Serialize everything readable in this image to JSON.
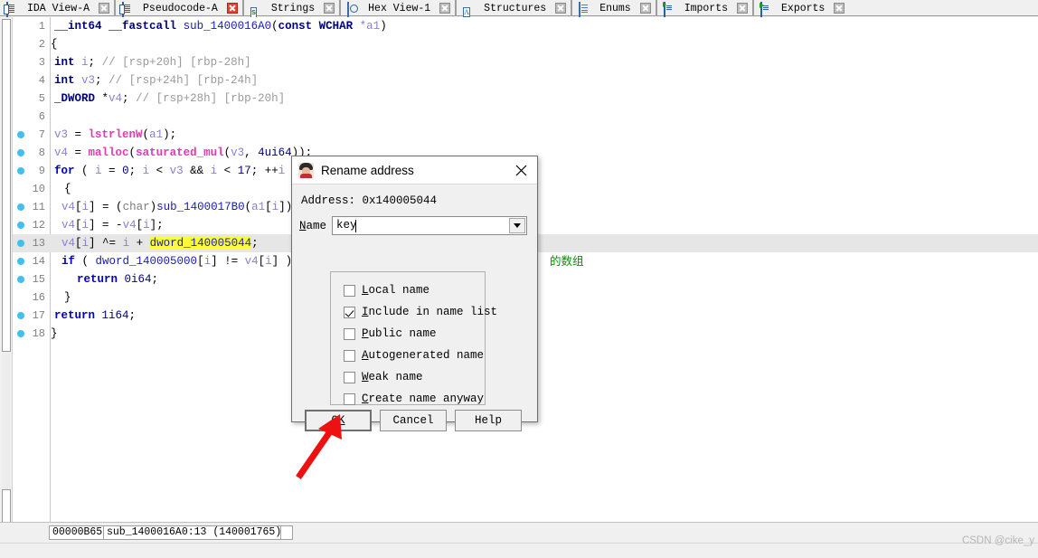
{
  "tabs": [
    {
      "label": "IDA View-A",
      "icon": "document-icon",
      "close_active": false
    },
    {
      "label": "Pseudocode-A",
      "icon": "document-icon",
      "close_active": true
    },
    {
      "label": "Strings",
      "icon": "strings-icon",
      "close_active": false
    },
    {
      "label": "Hex View-1",
      "icon": "hex-view-icon",
      "close_active": false
    },
    {
      "label": "Structures",
      "icon": "structures-icon",
      "close_active": false
    },
    {
      "label": "Enums",
      "icon": "enums-icon",
      "close_active": false
    },
    {
      "label": "Imports",
      "icon": "imports-icon",
      "close_active": false
    },
    {
      "label": "Exports",
      "icon": "exports-icon",
      "close_active": false
    }
  ],
  "code": {
    "lines": [
      {
        "num": "1",
        "breakpoint": false,
        "highlight": false
      },
      {
        "num": "2",
        "breakpoint": false,
        "highlight": false
      },
      {
        "num": "3",
        "breakpoint": false,
        "highlight": false
      },
      {
        "num": "4",
        "breakpoint": false,
        "highlight": false
      },
      {
        "num": "5",
        "breakpoint": false,
        "highlight": false
      },
      {
        "num": "6",
        "breakpoint": false,
        "highlight": false
      },
      {
        "num": "7",
        "breakpoint": true,
        "highlight": false
      },
      {
        "num": "8",
        "breakpoint": true,
        "highlight": false
      },
      {
        "num": "9",
        "breakpoint": true,
        "highlight": false
      },
      {
        "num": "10",
        "breakpoint": false,
        "highlight": false
      },
      {
        "num": "11",
        "breakpoint": true,
        "highlight": false
      },
      {
        "num": "12",
        "breakpoint": true,
        "highlight": false
      },
      {
        "num": "13",
        "breakpoint": true,
        "highlight": true
      },
      {
        "num": "14",
        "breakpoint": true,
        "highlight": false
      },
      {
        "num": "15",
        "breakpoint": true,
        "highlight": false
      },
      {
        "num": "16",
        "breakpoint": false,
        "highlight": false
      },
      {
        "num": "17",
        "breakpoint": true,
        "highlight": false
      },
      {
        "num": "18",
        "breakpoint": true,
        "highlight": false
      }
    ],
    "text": {
      "l1": "__int64 __fastcall sub_1400016A0(const WCHAR *a1)",
      "l2": "{",
      "l3_a": "  int i; ",
      "l3_b": "// [rsp+20h] [rbp-28h]",
      "l4_a": "  int v3; ",
      "l4_b": "// [rsp+24h] [rbp-24h]",
      "l5_a": "  _DWORD *v4; ",
      "l5_b": "// [rsp+28h] [rbp-20h]",
      "l7": "v3 = lstrlenW(a1);",
      "l8": "v4 = malloc(saturated_mul(v3, 4ui64));",
      "l9": "for ( i = 0; i < v3 && i < 17; ++i )",
      "l10": "  {",
      "l11": "v4[i] = (char)sub_1400017B0(a1[i]);",
      "l12": "v4[i] = -v4[i];",
      "l13": "v4[i] ^= i + dword_140005044;",
      "l14": "if ( dword_140005000[i] != v4[i] )",
      "l15": "return 0i64;",
      "l16": "  }",
      "l17": "  return 1i64;",
      "l18": "}",
      "comment_cjk": "的数组"
    },
    "tokens": {
      "int64": "__int64",
      "fastcall": "__fastcall",
      "funcname": "sub_1400016A0",
      "const": "const",
      "wchar": "WCHAR",
      "a1": "*a1",
      "int": "int",
      "dword_t": "_DWORD",
      "i": "i",
      "v3": "v3",
      "v4": "v4",
      "lstrlenw": "lstrlenW",
      "malloc": "malloc",
      "saturated_mul": "saturated_mul",
      "for": "for",
      "if": "if",
      "return": "return",
      "char": "char",
      "sub_1400017B0": "sub_1400017B0",
      "dword_140005044": "dword_140005044",
      "dword_140005000": "dword_140005000"
    }
  },
  "dialog": {
    "title": "Rename address",
    "icon": "rename-person-icon",
    "close_icon": "close-icon",
    "address_label": "Address: 0x140005044",
    "name_label_prefix": "N",
    "name_label_rest": "ame",
    "name_value": "key",
    "dropdown_icon": "chevron-down-icon",
    "checkboxes": [
      {
        "accel": "L",
        "rest": "ocal name",
        "checked": false
      },
      {
        "accel": "I",
        "rest": "nclude in name list",
        "checked": true
      },
      {
        "accel": "P",
        "rest": "ublic name",
        "checked": false
      },
      {
        "accel": "A",
        "rest": "utogenerated name",
        "checked": false
      },
      {
        "accel": "W",
        "rest": "eak name",
        "checked": false
      },
      {
        "accel": "C",
        "rest": "reate name anyway",
        "checked": false
      }
    ],
    "buttons": {
      "ok_prefix": "O",
      "ok_accel": "K",
      "ok_full": "OK",
      "cancel": "Cancel",
      "help": "Help"
    }
  },
  "statusbar": {
    "offset": "00000B65",
    "location": "sub_1400016A0:13  (140001765)",
    "extra": "",
    "watermark": "CSDN @cike_y"
  },
  "colors": {
    "breakpoint": "#3ec1f0",
    "highlight_row": "#e6e6e6",
    "highlight_token": "#fcfc3c",
    "function": "#e23ab0",
    "variable": "#8a7fd4",
    "keyword": "#0000c0",
    "comment": "#9a9a9a",
    "comment_cjk": "#0c8a0c",
    "arrow": "#ee1111"
  }
}
